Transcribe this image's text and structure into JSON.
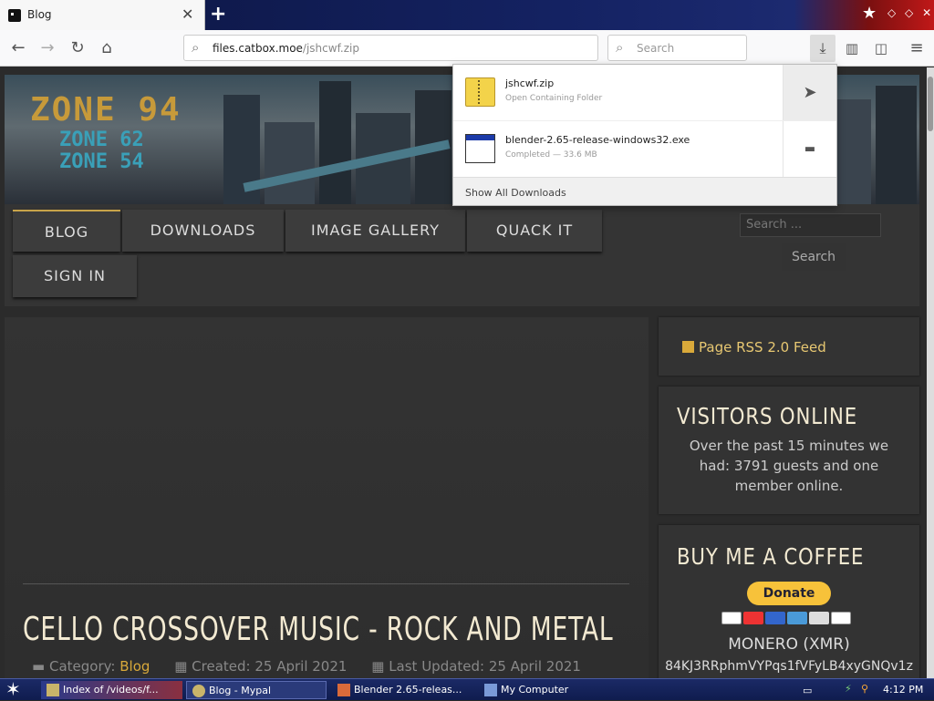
{
  "browser": {
    "tab_title": "Blog",
    "new_tab_label": "+",
    "url_domain": "files.catbox.moe",
    "url_path": "/jshcwf.zip",
    "search_placeholder": "Search"
  },
  "downloads": {
    "items": [
      {
        "name": "jshcwf.zip",
        "status": "Open Containing Folder"
      },
      {
        "name": "blender-2.65-release-windows32.exe",
        "status": "Completed — 33.6 MB"
      }
    ],
    "show_all": "Show All Downloads"
  },
  "site": {
    "logo_main": "ZONE 94",
    "logo_sub1": "ZONE 62",
    "logo_sub2": "ZONE 54",
    "menu": [
      "BLOG",
      "DOWNLOADS",
      "IMAGE GALLERY",
      "QUACK IT",
      "SIGN IN"
    ],
    "search_placeholder": "Search ...",
    "search_button": "Search",
    "article": {
      "title": "CELLO CROSSOVER MUSIC - ROCK AND METAL",
      "category_label": "Category:",
      "category": "Blog",
      "created": "Created: 25 April 2021",
      "updated": "Last Updated: 25 April 2021"
    },
    "sidebar": {
      "rss": "Page RSS 2.0 Feed",
      "visitors_title": "VISITORS ONLINE",
      "visitors_text": "Over the past 15 minutes we had: 3791 guests and one member online.",
      "coffee_title": "BUY ME A COFFEE",
      "donate": "Donate",
      "monero_label": "MONERO (XMR)",
      "monero_address": "84KJ3RRphmVYPqs1fVFyLB4xyGNQv1z"
    }
  },
  "taskbar": {
    "tasks": [
      "Index of /videos/f...",
      "Blog - Mypal",
      "Blender 2.65-releas...",
      "My Computer"
    ],
    "clock": "4:12 PM"
  },
  "colors": {
    "accent": "#d9a93a",
    "heading": "#f3ead2",
    "donate": "#f7c23a"
  }
}
